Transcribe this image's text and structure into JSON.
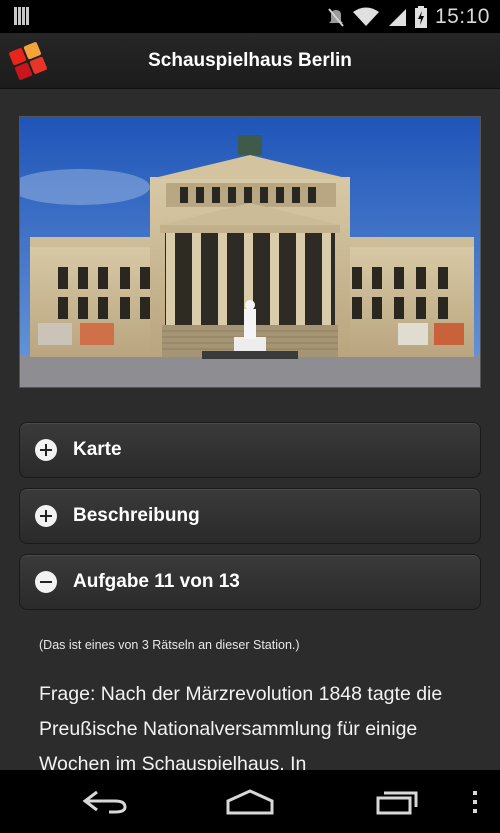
{
  "status_bar": {
    "time": "15:10",
    "icons": [
      "notification-bars-icon",
      "mute-icon",
      "wifi-icon",
      "signal-icon",
      "battery-charging-icon"
    ]
  },
  "action_bar": {
    "title": "Schauspielhaus Berlin",
    "app_icon": "app-logo-icon"
  },
  "photo": {
    "description_icon": "building-photo"
  },
  "accordion": [
    {
      "label": "Karte",
      "state": "collapsed",
      "icon": "plus-icon"
    },
    {
      "label": "Beschreibung",
      "state": "collapsed",
      "icon": "plus-icon"
    },
    {
      "label": "Aufgabe 11 von 13",
      "state": "expanded",
      "icon": "minus-icon"
    }
  ],
  "task": {
    "note": "(Das ist eines von 3 Rätseln an dieser Station.)",
    "question": "Frage: Nach der Märzrevolution 1848 tagte die Preußische Nationalversammlung für einige Wochen im Schauspielhaus. In"
  },
  "nav_bar": {
    "icons": [
      "back-icon",
      "home-icon",
      "recent-apps-icon",
      "overflow-menu-icon"
    ]
  }
}
